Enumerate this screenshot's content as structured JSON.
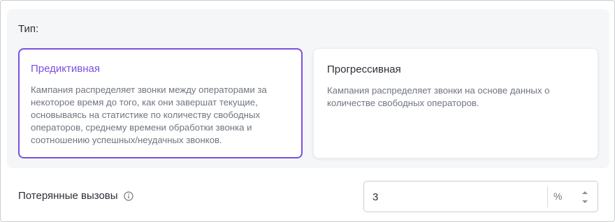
{
  "type_section": {
    "label": "Тип:",
    "options": [
      {
        "title": "Предиктивная",
        "description": "Кампания распределяет звонки между операторами за некоторое время до того, как они завершат текущие, основываясь на статистике по количеству свободных операторов, среднему времени обработки звонка и соотношению успешных/неудачных звонков.",
        "selected": true
      },
      {
        "title": "Прогрессивная",
        "description": "Кампания распределяет звонки на основе данных о количестве свободных операторов.",
        "selected": false
      }
    ]
  },
  "lost_calls": {
    "label": "Потерянные вызовы",
    "info_icon": "info-icon",
    "value": "3",
    "unit": "%"
  },
  "colors": {
    "accent": "#7b4fe0",
    "panel_bg": "#f5f6f8",
    "text": "#2b2f36",
    "muted_text": "#6f7580"
  }
}
